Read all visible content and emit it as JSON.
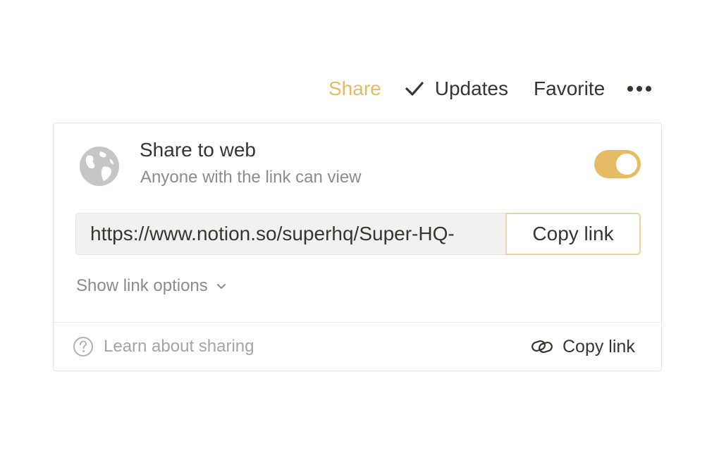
{
  "topbar": {
    "share_label": "Share",
    "updates_label": "Updates",
    "favorite_label": "Favorite",
    "more_icon": "ellipsis-icon"
  },
  "share_panel": {
    "title": "Share to web",
    "subtitle": "Anyone with the link can view",
    "toggle_on": true,
    "url_value": "https://www.notion.so/superhq/Super-HQ-",
    "copy_button_label": "Copy link",
    "link_options_label": "Show link options",
    "learn_label": "Learn about sharing",
    "footer_copy_label": "Copy link"
  },
  "colors": {
    "accent": "#e5bc65",
    "text": "#37352f",
    "muted": "#8e8c88",
    "icon_gray": "#c7c6c4"
  }
}
